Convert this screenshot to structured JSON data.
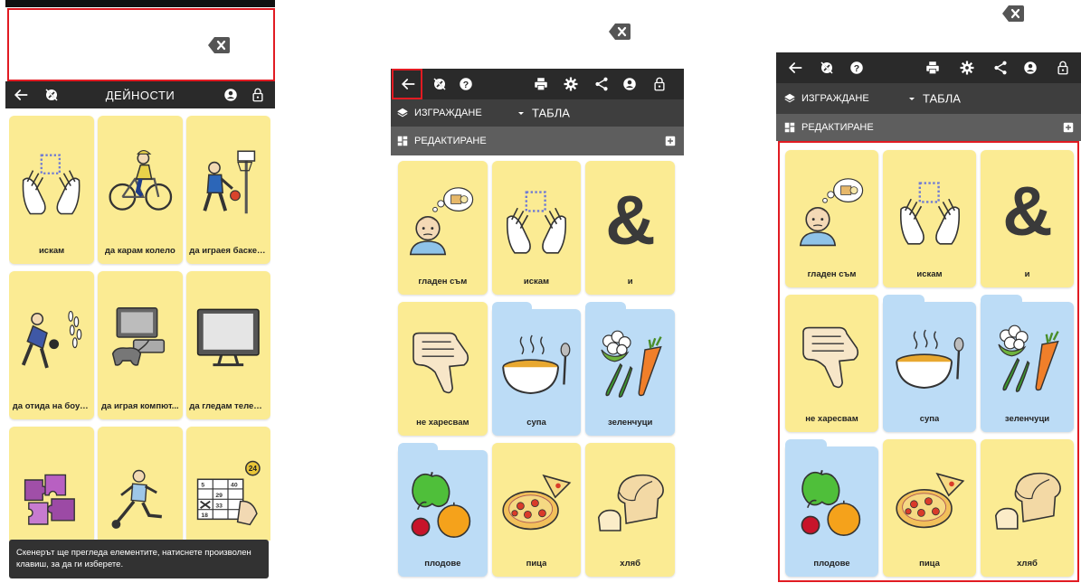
{
  "panel1": {
    "navbar": {
      "title": "ДЕЙНОСТИ"
    },
    "tiles": [
      {
        "label": "искам",
        "color": "yellow",
        "icon": "want-hands-icon"
      },
      {
        "label": "да карам колело",
        "color": "yellow",
        "icon": "bicycle-icon"
      },
      {
        "label": "да играея баскетб...",
        "color": "yellow",
        "icon": "basketball-icon"
      },
      {
        "label": "да отида на боули...",
        "color": "yellow",
        "icon": "bowling-icon"
      },
      {
        "label": "да играя компют...",
        "color": "yellow",
        "icon": "video-game-icon"
      },
      {
        "label": "да гледам телеви...",
        "color": "yellow",
        "icon": "tv-icon"
      },
      {
        "label": "",
        "color": "yellow",
        "icon": "puzzle-icon"
      },
      {
        "label": "",
        "color": "yellow",
        "icon": "football-icon"
      },
      {
        "label": "",
        "color": "yellow",
        "icon": "bingo-icon"
      }
    ],
    "toast": "Скенерът ще прегледа елементите, натиснете произволен клавиш, за да ги изберете."
  },
  "panel2": {
    "bar2": {
      "build_label": "ИЗГРАЖДАНЕ",
      "boards_label": "ТАБЛА"
    },
    "bar3": {
      "edit_label": "РЕДАКТИРАНЕ"
    },
    "tiles": [
      {
        "label": "гладен съм",
        "color": "yellow",
        "icon": "hungry-icon"
      },
      {
        "label": "искам",
        "color": "yellow",
        "icon": "want-hands-icon"
      },
      {
        "label": "и",
        "color": "yellow",
        "icon": "ampersand-icon"
      },
      {
        "label": "не харесвам",
        "color": "yellow",
        "icon": "thumbs-down-icon"
      },
      {
        "label": "супа",
        "color": "blue",
        "icon": "soup-icon"
      },
      {
        "label": "зеленчуци",
        "color": "blue",
        "icon": "vegetables-icon"
      },
      {
        "label": "плодове",
        "color": "blue",
        "icon": "fruits-icon"
      },
      {
        "label": "пица",
        "color": "yellow",
        "icon": "pizza-icon"
      },
      {
        "label": "хляб",
        "color": "yellow",
        "icon": "bread-icon"
      }
    ]
  },
  "panel3": {
    "bar2": {
      "build_label": "ИЗГРАЖДАНЕ",
      "boards_label": "ТАБЛА"
    },
    "bar3": {
      "edit_label": "РЕДАКТИРАНЕ"
    },
    "tiles": [
      {
        "label": "гладен съм",
        "color": "yellow",
        "icon": "hungry-icon"
      },
      {
        "label": "искам",
        "color": "yellow",
        "icon": "want-hands-icon"
      },
      {
        "label": "и",
        "color": "yellow",
        "icon": "ampersand-icon"
      },
      {
        "label": "не харесвам",
        "color": "yellow",
        "icon": "thumbs-down-icon"
      },
      {
        "label": "супа",
        "color": "blue",
        "icon": "soup-icon"
      },
      {
        "label": "зеленчуци",
        "color": "blue",
        "icon": "vegetables-icon"
      },
      {
        "label": "плодове",
        "color": "blue",
        "icon": "fruits-icon"
      },
      {
        "label": "пица",
        "color": "yellow",
        "icon": "pizza-icon"
      },
      {
        "label": "хляб",
        "color": "yellow",
        "icon": "bread-icon"
      }
    ]
  },
  "colors": {
    "tile_yellow": "#fbeb93",
    "tile_blue": "#bcdcf6",
    "navbar": "#2a2a2a",
    "highlight": "#e11b22"
  }
}
